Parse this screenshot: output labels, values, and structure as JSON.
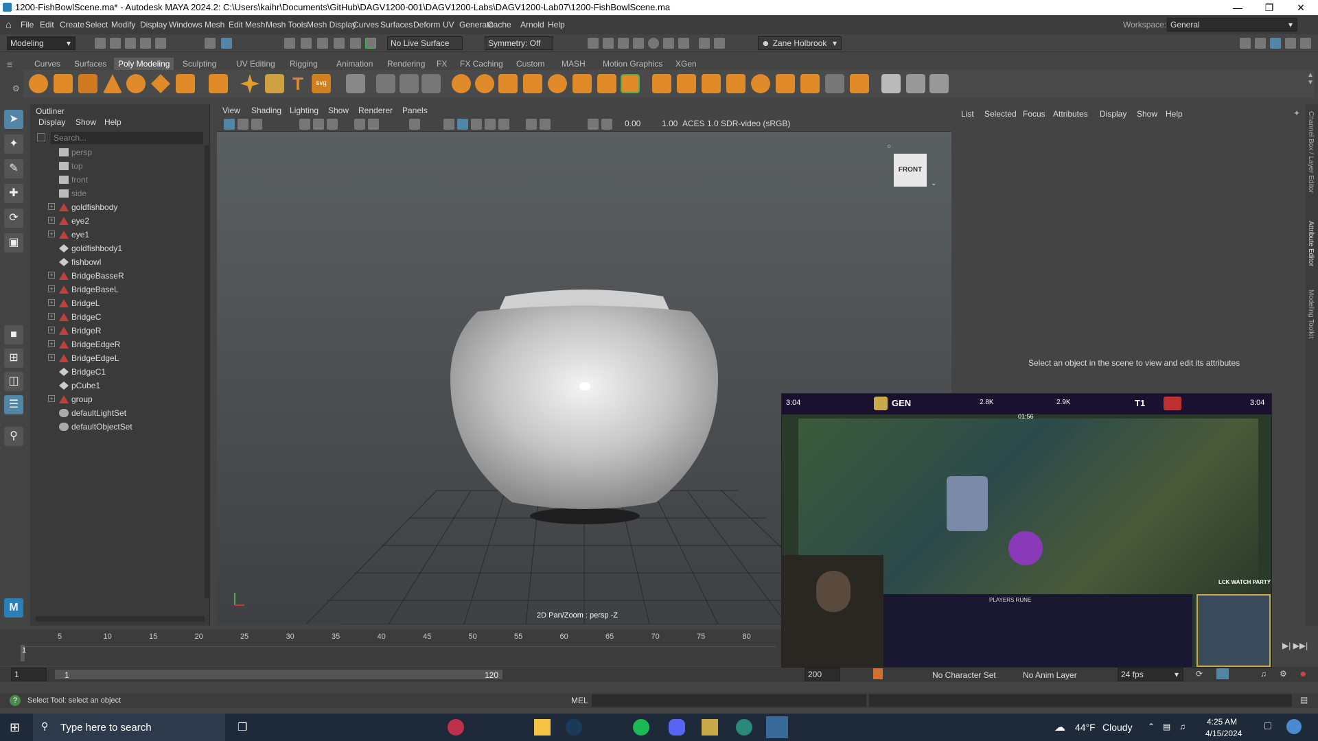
{
  "titlebar": {
    "title": "1200-FishBowlScene.ma* - Autodesk MAYA 2024.2: C:\\Users\\kaihr\\Documents\\GitHub\\DAGV1200-001\\DAGV1200-Labs\\DAGV1200-Lab07\\1200-FishBowlScene.ma"
  },
  "menubar": {
    "items": [
      "File",
      "Edit",
      "Create",
      "Select",
      "Modify",
      "Display",
      "Windows",
      "Mesh",
      "Edit Mesh",
      "Mesh Tools",
      "Mesh Display",
      "Curves",
      "Surfaces",
      "Deform",
      "UV",
      "Generate",
      "Cache",
      "Arnold",
      "Help"
    ],
    "workspace_label": "Workspace:",
    "workspace_value": "General"
  },
  "toolbar": {
    "mode": "Modeling",
    "live_surface": "No Live Surface",
    "symmetry": "Symmetry: Off",
    "user": "Zane Holbrook"
  },
  "shelf": {
    "tabs": [
      "Curves",
      "Surfaces",
      "Poly Modeling",
      "Sculpting",
      "UV Editing",
      "Rigging",
      "Animation",
      "Rendering",
      "FX",
      "FX Caching",
      "Custom",
      "MASH",
      "Motion Graphics",
      "XGen"
    ],
    "active": "Poly Modeling"
  },
  "outliner": {
    "title": "Outliner",
    "menu": [
      "Display",
      "Show",
      "Help"
    ],
    "search_placeholder": "Search...",
    "items": [
      {
        "label": "persp",
        "type": "camera",
        "dim": true,
        "expand": false
      },
      {
        "label": "top",
        "type": "camera",
        "dim": true,
        "expand": false
      },
      {
        "label": "front",
        "type": "camera",
        "dim": true,
        "expand": false
      },
      {
        "label": "side",
        "type": "camera",
        "dim": true,
        "expand": false
      },
      {
        "label": "goldfishbody",
        "type": "group",
        "dim": false,
        "expand": true
      },
      {
        "label": "eye2",
        "type": "group",
        "dim": false,
        "expand": true
      },
      {
        "label": "eye1",
        "type": "group",
        "dim": false,
        "expand": true
      },
      {
        "label": "goldfishbody1",
        "type": "mesh",
        "dim": false,
        "expand": false
      },
      {
        "label": "fishbowl",
        "type": "mesh",
        "dim": false,
        "expand": false
      },
      {
        "label": "BridgeBasseR",
        "type": "group",
        "dim": false,
        "expand": true
      },
      {
        "label": "BridgeBaseL",
        "type": "group",
        "dim": false,
        "expand": true
      },
      {
        "label": "BridgeL",
        "type": "group",
        "dim": false,
        "expand": true
      },
      {
        "label": "BridgeC",
        "type": "group",
        "dim": false,
        "expand": true
      },
      {
        "label": "BridgeR",
        "type": "group",
        "dim": false,
        "expand": true
      },
      {
        "label": "BridgeEdgeR",
        "type": "group",
        "dim": false,
        "expand": true
      },
      {
        "label": "BridgeEdgeL",
        "type": "group",
        "dim": false,
        "expand": true
      },
      {
        "label": "BridgeC1",
        "type": "mesh",
        "dim": false,
        "expand": false
      },
      {
        "label": "pCube1",
        "type": "mesh",
        "dim": false,
        "expand": false
      },
      {
        "label": "group",
        "type": "group",
        "dim": false,
        "expand": true
      },
      {
        "label": "defaultLightSet",
        "type": "set",
        "dim": false,
        "expand": false
      },
      {
        "label": "defaultObjectSet",
        "type": "set",
        "dim": false,
        "expand": false
      }
    ]
  },
  "viewport": {
    "menu": [
      "View",
      "Shading",
      "Lighting",
      "Show",
      "Renderer",
      "Panels"
    ],
    "value1": "0.00",
    "value2": "1.00",
    "colorspace": "ACES 1.0 SDR-video (sRGB)",
    "cube_label": "FRONT",
    "status": "2D Pan/Zoom : persp -Z"
  },
  "attribute_editor": {
    "menu": [
      "List",
      "Selected",
      "Focus",
      "Attributes",
      "Display",
      "Show",
      "Help"
    ],
    "message": "Select an object in the scene to view and edit its attributes",
    "side_tabs": [
      "Channel Box / Layer Editor",
      "Attribute Editor",
      "Modeling Toolkit"
    ]
  },
  "timeline": {
    "ticks": [
      "5",
      "10",
      "15",
      "20",
      "25",
      "30",
      "35",
      "40",
      "45",
      "50",
      "55",
      "60",
      "65",
      "70",
      "75",
      "80"
    ],
    "current": "1"
  },
  "range": {
    "start": "1",
    "inner_start": "1",
    "inner_end": "120",
    "end": "200",
    "character_set": "No Character Set",
    "anim_layer": "No Anim Layer",
    "fps": "24 fps"
  },
  "status": {
    "help": "Select Tool: select an object",
    "mel": "MEL"
  },
  "stream": {
    "time_left": "3:04",
    "time_right": "3:04",
    "team_left": "GEN",
    "team_right": "T1",
    "gold_left": "2.8K",
    "gold_right": "2.9K",
    "clock": "01:56",
    "watch_party": "LCK WATCH PARTY",
    "runes": "PLAYERS RUNE"
  },
  "taskbar": {
    "search_placeholder": "Type here to search",
    "weather_temp": "44°F",
    "weather_desc": "Cloudy",
    "time": "4:25 AM",
    "date": "4/15/2024"
  },
  "colors": {
    "accent": "#5285a6",
    "viewport_bg": "#5a5f62",
    "bowl": "#c8c8c8"
  }
}
